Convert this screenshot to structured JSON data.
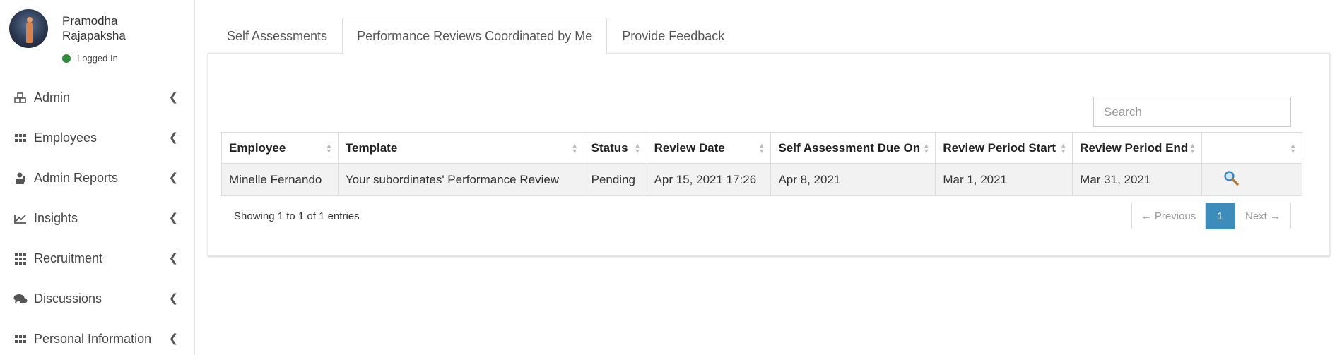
{
  "user": {
    "name": "Pramodha Rajapaksha",
    "status": "Logged In",
    "status_color": "#2e8b3a"
  },
  "sidebar": {
    "items": [
      {
        "label": "Admin",
        "icon": "cubes-icon"
      },
      {
        "label": "Employees",
        "icon": "grid-icon"
      },
      {
        "label": "Admin Reports",
        "icon": "user-report-icon"
      },
      {
        "label": "Insights",
        "icon": "line-chart-icon"
      },
      {
        "label": "Recruitment",
        "icon": "th-icon"
      },
      {
        "label": "Discussions",
        "icon": "comments-icon"
      },
      {
        "label": "Personal Information",
        "icon": "grid-icon"
      }
    ]
  },
  "tabs": [
    {
      "label": "Self Assessments",
      "active": false
    },
    {
      "label": "Performance Reviews Coordinated by Me",
      "active": true
    },
    {
      "label": "Provide Feedback",
      "active": false
    }
  ],
  "search": {
    "placeholder": "Search"
  },
  "table": {
    "columns": [
      "Employee",
      "Template",
      "Status",
      "Review Date",
      "Self Assessment Due On",
      "Review Period Start",
      "Review Period End",
      ""
    ],
    "rows": [
      [
        "Minelle Fernando",
        "Your subordinates' Performance Review",
        "Pending",
        "Apr 15, 2021 17:26",
        "Apr 8, 2021",
        "Mar 1, 2021",
        "Mar 31, 2021"
      ]
    ],
    "row_action_icon": "search-icon"
  },
  "footer": {
    "info": "Showing 1 to 1 of 1 entries",
    "prev": "← Previous",
    "current_page": "1",
    "next": "Next →"
  },
  "colors": {
    "accent": "#3c8dbc"
  }
}
